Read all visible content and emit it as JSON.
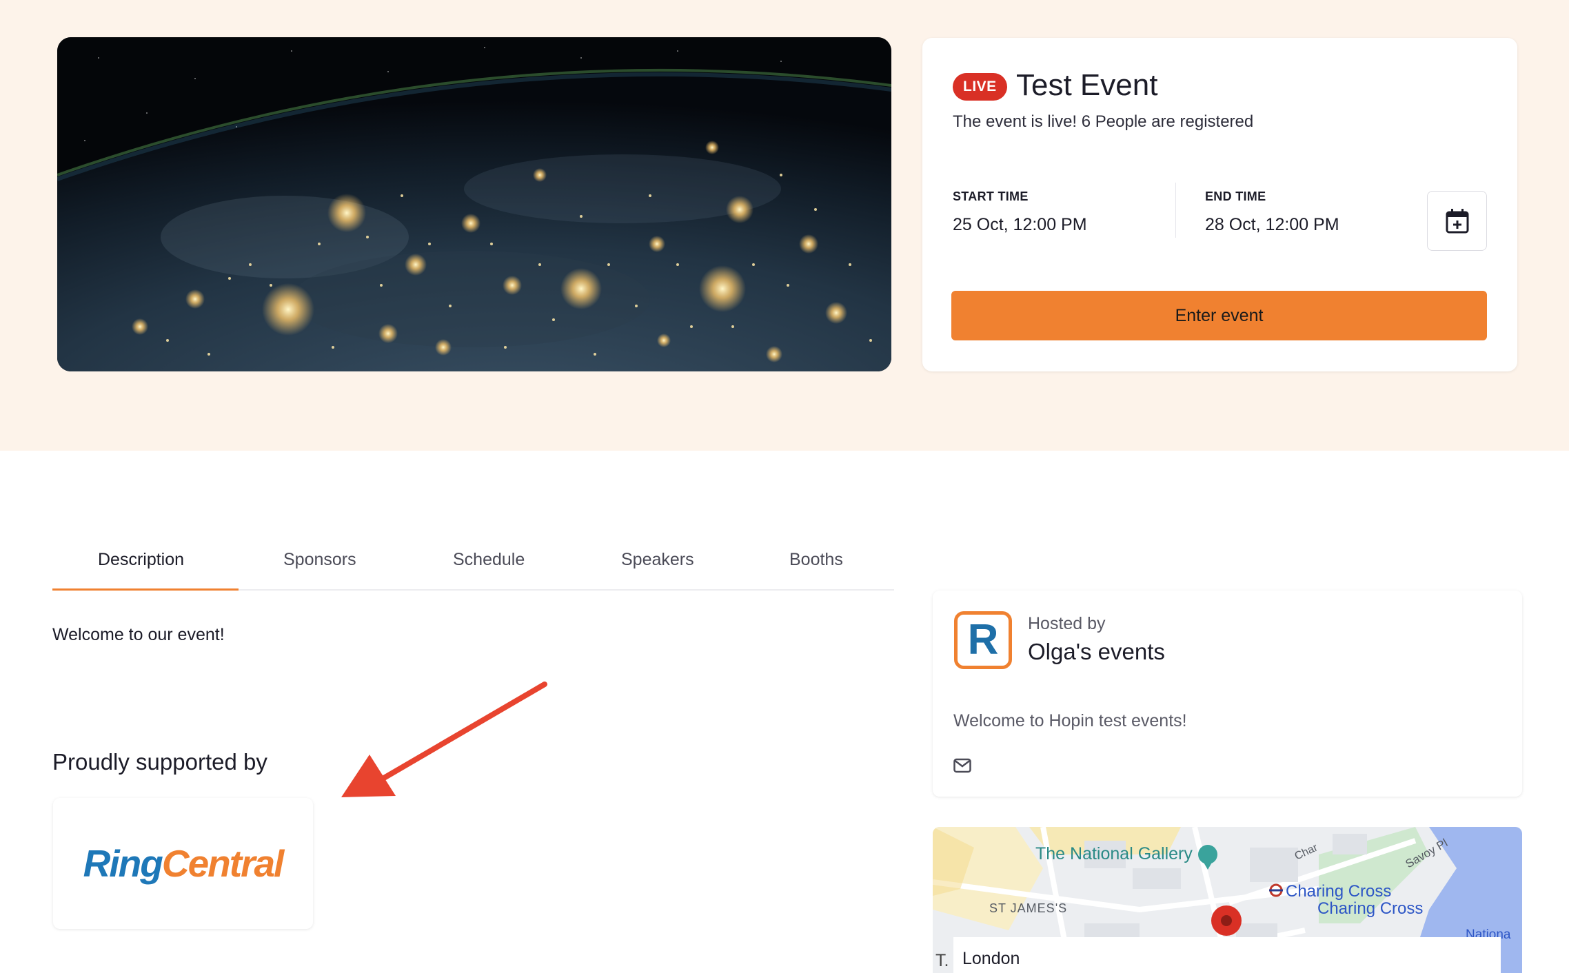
{
  "event": {
    "live_badge": "LIVE",
    "title": "Test Event",
    "status": "The event is live! 6 People are registered",
    "start_label": "START TIME",
    "start_value": "25 Oct, 12:00 PM",
    "end_label": "END TIME",
    "end_value": "28 Oct, 12:00 PM",
    "enter_label": "Enter event",
    "calendar_icon": "calendar-add-icon"
  },
  "tabs": [
    {
      "label": "Description",
      "active": true
    },
    {
      "label": "Sponsors",
      "active": false
    },
    {
      "label": "Schedule",
      "active": false
    },
    {
      "label": "Speakers",
      "active": false
    },
    {
      "label": "Booths",
      "active": false
    }
  ],
  "description": {
    "welcome": "Welcome to our event!",
    "supported_heading": "Proudly supported by",
    "sponsor_logo_part1": "Ring",
    "sponsor_logo_part2": "Central"
  },
  "host": {
    "logo_letter": "R",
    "hosted_by": "Hosted by",
    "name": "Olga's events",
    "description": "Welcome to Hopin test events!",
    "contact_icon": "mail-icon"
  },
  "map": {
    "place_national_gallery": "The National Gallery",
    "place_st_james": "ST JAMES'S",
    "place_charing_cross_1": "Charing Cross",
    "place_charing_cross_2": "Charing Cross",
    "place_savoy": "Savoy Pl",
    "place_national_partial": "Nationa",
    "place_char_partial": "Char",
    "location_label": "London",
    "side_letter": "T."
  },
  "colors": {
    "accent": "#f08130",
    "live": "#d93025",
    "hero_background": "#fdf3ea",
    "brand_blue": "#1e78b8"
  }
}
